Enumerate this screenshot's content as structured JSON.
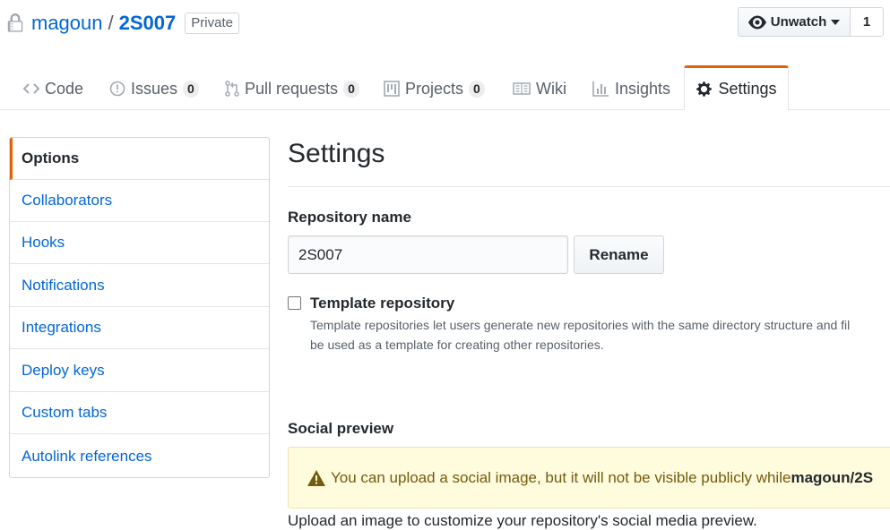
{
  "repo": {
    "owner": "magoun",
    "separator": "/",
    "name": "2S007",
    "visibility_badge": "Private",
    "lock_icon": "lock-icon"
  },
  "watch": {
    "label": "Unwatch",
    "count": "1",
    "icon": "eye-icon"
  },
  "tabs": [
    {
      "label": "Code",
      "icon": "code-icon"
    },
    {
      "label": "Issues",
      "count": "0",
      "icon": "issue-icon"
    },
    {
      "label": "Pull requests",
      "count": "0",
      "icon": "pull-request-icon"
    },
    {
      "label": "Projects",
      "count": "0",
      "icon": "project-icon"
    },
    {
      "label": "Wiki",
      "icon": "book-icon"
    },
    {
      "label": "Insights",
      "icon": "graph-icon"
    },
    {
      "label": "Settings",
      "icon": "gear-icon",
      "active": true
    }
  ],
  "sidebar": {
    "items": [
      {
        "label": "Options",
        "selected": true
      },
      {
        "label": "Collaborators"
      },
      {
        "label": "Hooks"
      },
      {
        "label": "Notifications"
      },
      {
        "label": "Integrations"
      },
      {
        "label": "Deploy keys"
      },
      {
        "label": "Custom tabs"
      },
      {
        "label": "Autolink references"
      }
    ]
  },
  "main": {
    "title": "Settings",
    "repo_name_label": "Repository name",
    "repo_name_value": "2S007",
    "rename_button": "Rename",
    "template_title": "Template repository",
    "template_desc": "Template repositories let users generate new repositories with the same directory structure and fil",
    "template_desc2": "be used as a template for creating other repositories.",
    "social_label": "Social preview",
    "social_flash_text": "You can upload a social image, but it will not be visible publicly while ",
    "social_flash_repo": "magoun/2S",
    "upload_text": "Upload an image to customize your repository's social media preview."
  },
  "colors": {
    "link": "#0366d6",
    "accent": "#e36209",
    "flash_bg": "#fffbdd"
  }
}
